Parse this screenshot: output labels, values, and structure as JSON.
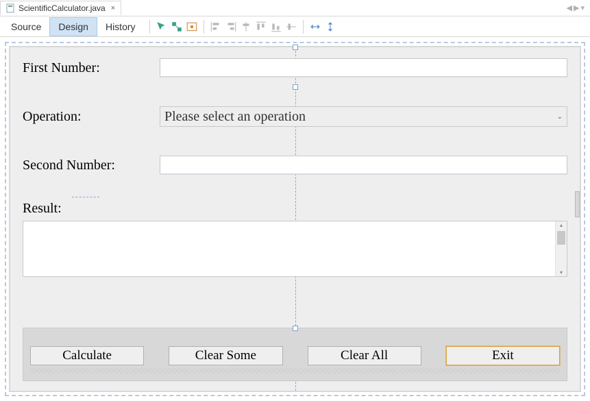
{
  "tab": {
    "title": "ScientificCalculator.java"
  },
  "views": {
    "source": "Source",
    "design": "Design",
    "history": "History"
  },
  "form": {
    "first_label": "First Number:",
    "operation_label": "Operation:",
    "operation_placeholder": "Please select an operation",
    "second_label": "Second Number:",
    "result_label": "Result:"
  },
  "buttons": {
    "calculate": "Calculate",
    "clear_some": "Clear Some",
    "clear_all": "Clear All",
    "exit": "Exit"
  }
}
